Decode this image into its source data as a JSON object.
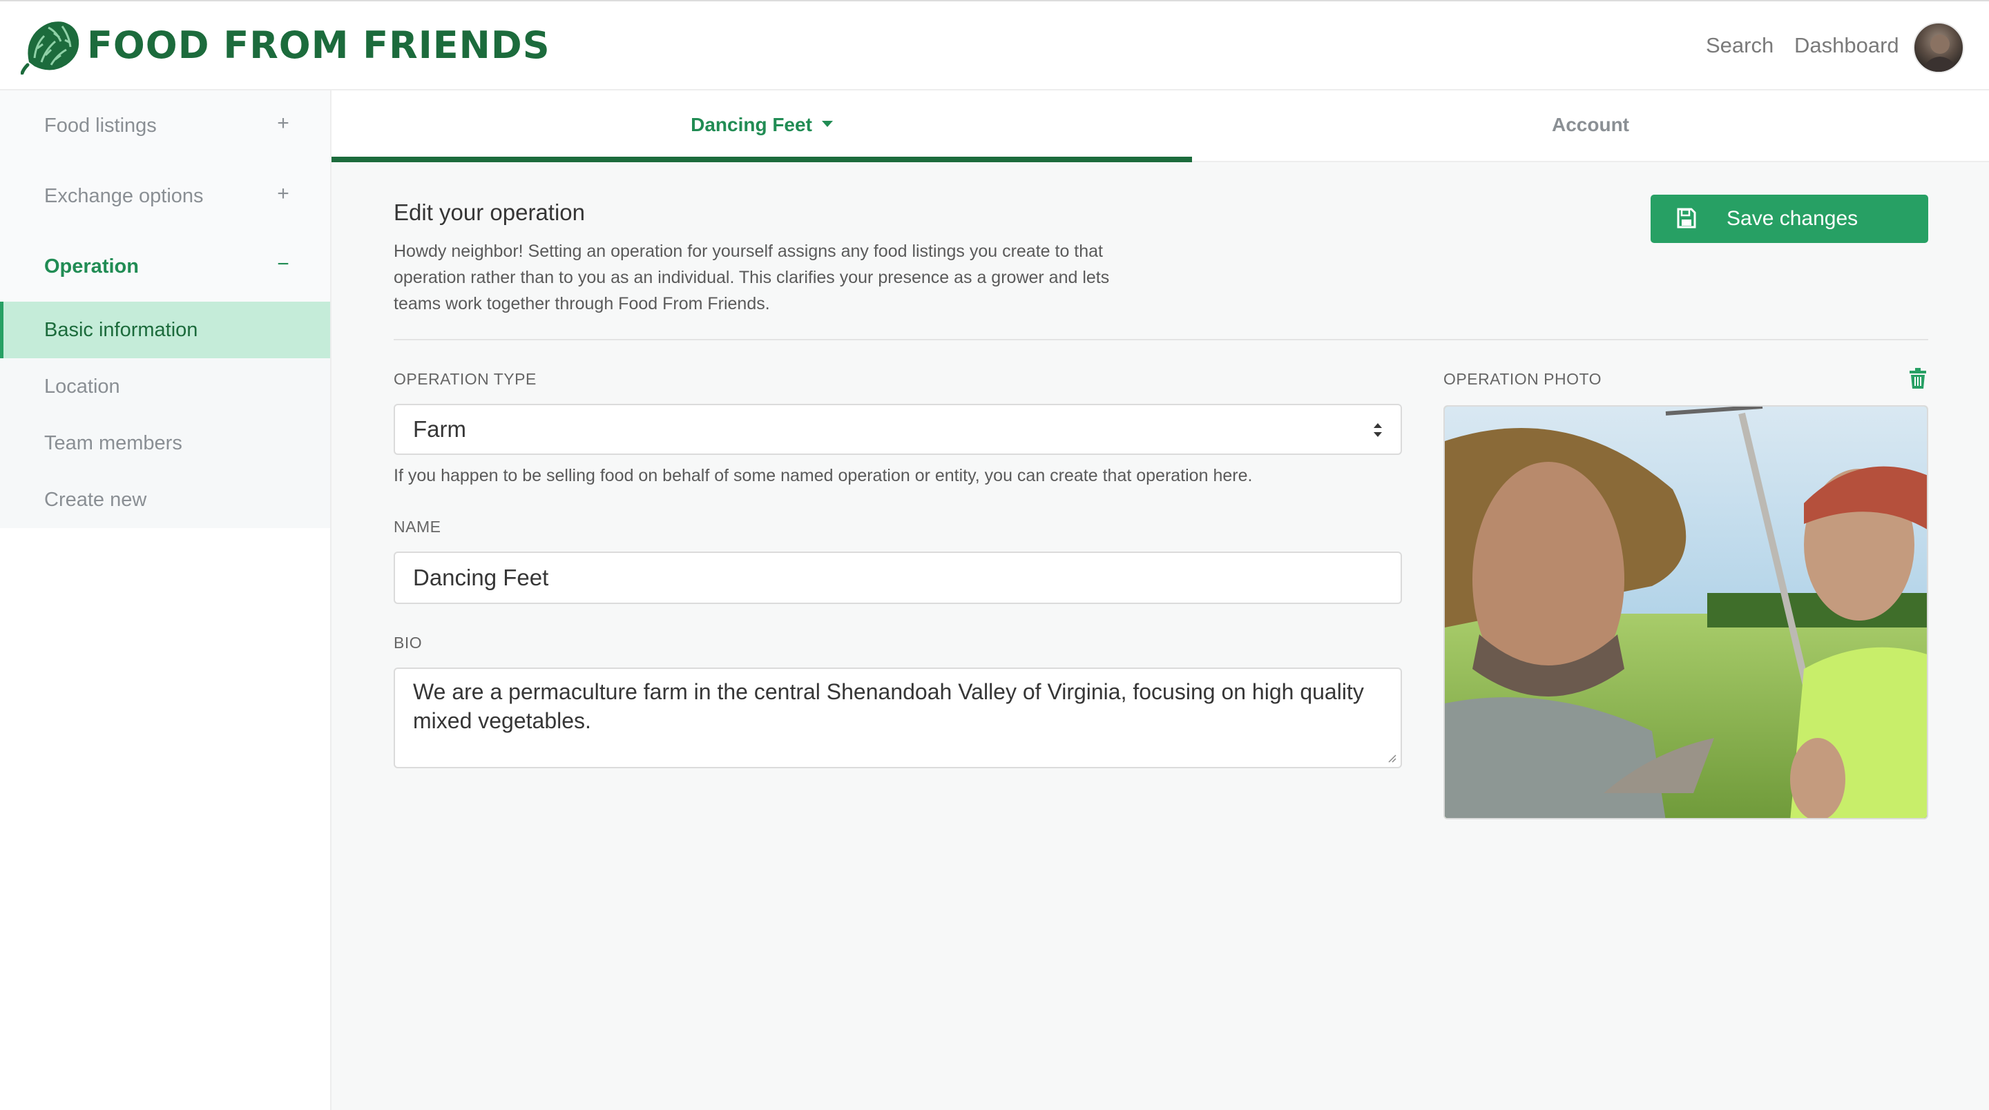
{
  "app": {
    "brand": "FOOD FROM FRIENDS",
    "colors": {
      "brand_green": "#1c6b3c",
      "accent_green": "#27a064",
      "active_bg": "#c5ecd9"
    }
  },
  "header": {
    "nav": {
      "search": "Search",
      "dashboard": "Dashboard"
    },
    "avatar_icon": "user-avatar"
  },
  "sidebar": {
    "groups": [
      {
        "label": "Food listings",
        "toggle": "+"
      },
      {
        "label": "Exchange options",
        "toggle": "+"
      },
      {
        "label": "Operation",
        "toggle": "−"
      }
    ],
    "operation_items": [
      {
        "label": "Basic information"
      },
      {
        "label": "Location"
      },
      {
        "label": "Team members"
      },
      {
        "label": "Create new"
      }
    ]
  },
  "tabs": {
    "operation": "Dancing Feet",
    "account": "Account"
  },
  "main": {
    "title": "Edit your operation",
    "intro": "Howdy neighbor! Setting an operation for yourself assigns any food listings you create to that operation rather than to you as an individual. This clarifies your presence as a grower and lets teams work together through Food From Friends.",
    "save_button": "Save changes",
    "save_icon": "floppy-disk-icon",
    "operation_type": {
      "label": "OPERATION TYPE",
      "value": "Farm",
      "help": "If you happen to be selling food on behalf of some named operation or entity, you can create that operation here."
    },
    "name": {
      "label": "NAME",
      "value": "Dancing Feet"
    },
    "bio": {
      "label": "BIO",
      "value": "We are a permaculture farm in the central Shenandoah Valley of Virginia, focusing on high quality mixed vegetables."
    },
    "photo": {
      "label": "OPERATION PHOTO",
      "delete_icon": "trash-icon"
    }
  }
}
